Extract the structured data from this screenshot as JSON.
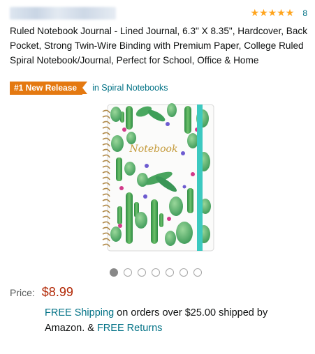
{
  "header": {
    "brand": "",
    "rating": {
      "stars": 5,
      "count": "8",
      "star_color": "#ffa41c"
    }
  },
  "product": {
    "title": "Ruled Notebook Journal - Lined Journal, 6.3\" X 8.35\", Hardcover, Back Pocket, Strong Twin-Wire Binding with Premium Paper, College Ruled Spiral Notebook/Journal, Perfect for School, Office & Home",
    "badge": {
      "label": "#1 New Release",
      "category": "in Spiral Notebooks",
      "color": "#e47911"
    },
    "image": {
      "cover_text": "Notebook",
      "dots_total": 7,
      "dots_active": 0
    },
    "price": {
      "label": "Price:",
      "value": "$8.99",
      "color": "#b12704"
    },
    "shipping": {
      "free_shipping": "FREE Shipping",
      "text": " on orders over $25.00 shipped by Amazon. & ",
      "free_returns": "FREE Returns"
    }
  },
  "colors": {
    "link": "#007185",
    "accent_band": "#3cc9c0"
  }
}
